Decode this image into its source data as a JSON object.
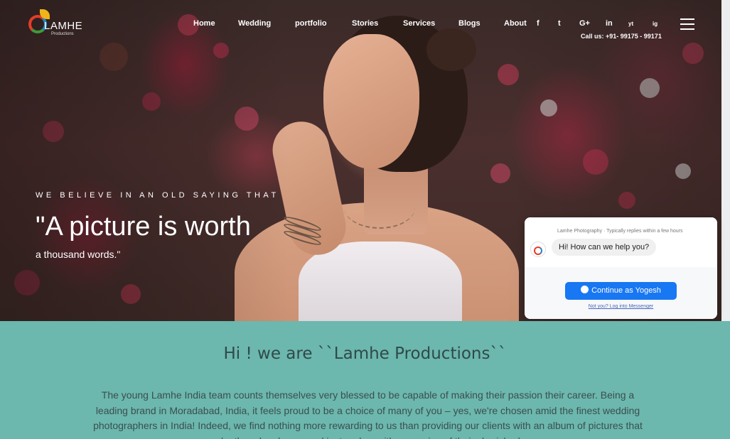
{
  "brand": {
    "logo_text": "LAMHE",
    "logo_sub": "Productions"
  },
  "nav": {
    "items": [
      "Home",
      "Wedding",
      "portfolio",
      "Stories",
      "Services",
      "Blogs",
      "About"
    ],
    "social": [
      "f",
      "t",
      "G+",
      "in",
      "yt",
      "ig"
    ],
    "call": "Call us: +91- 99175 - 99171"
  },
  "hero": {
    "tagline": "WE BELIEVE IN AN OLD SAYING THAT",
    "headline": "\"A picture is worth",
    "subline": "a thousand words.\""
  },
  "messenger": {
    "meta": "Lamhe Photography · Typically replies within a few hours",
    "greeting": "Hi! How can we help you?",
    "continue_label": "Continue as Yogesh",
    "login_link": "Not you? Log into Messenger"
  },
  "about": {
    "title": "Hi ! we are ``Lamhe Productions``",
    "text": "The young Lamhe India team counts themselves very blessed to be capable of making their passion their career. Being a leading brand in Moradabad, India, it feels proud to be a choice of many of you – yes, we're chosen amid the finest wedding photographers in India! Indeed, we find nothing more rewarding to us than providing our clients with an album of pictures that can make them laugh, cry, and just endow with memories of their cherished ones."
  },
  "colors": {
    "about_bg": "#6cb7ae",
    "messenger_blue": "#1877f2"
  }
}
